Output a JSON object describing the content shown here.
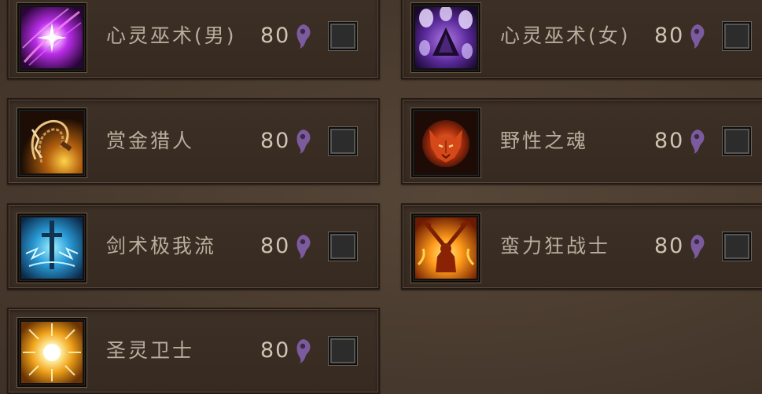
{
  "classes": [
    {
      "name": "心灵巫术(男)",
      "cost": "80",
      "icon": "psychic-male-icon",
      "checked": false
    },
    {
      "name": "心灵巫术(女)",
      "cost": "80",
      "icon": "psychic-female-icon",
      "checked": false
    },
    {
      "name": "赏金猎人",
      "cost": "80",
      "icon": "bounty-hunter-icon",
      "checked": false
    },
    {
      "name": "野性之魂",
      "cost": "80",
      "icon": "wild-soul-icon",
      "checked": false
    },
    {
      "name": "剑术极我流",
      "cost": "80",
      "icon": "swordsman-icon",
      "checked": false
    },
    {
      "name": "蛮力狂战士",
      "cost": "80",
      "icon": "berserker-icon",
      "checked": false
    },
    {
      "name": "圣灵卫士",
      "cost": "80",
      "icon": "holy-guardian-icon",
      "checked": false
    }
  ],
  "colors": {
    "soul": "#7c5a9e",
    "label": "#b9ad9c",
    "cost": "#cfc4b2",
    "panel": "#3a2d24"
  }
}
